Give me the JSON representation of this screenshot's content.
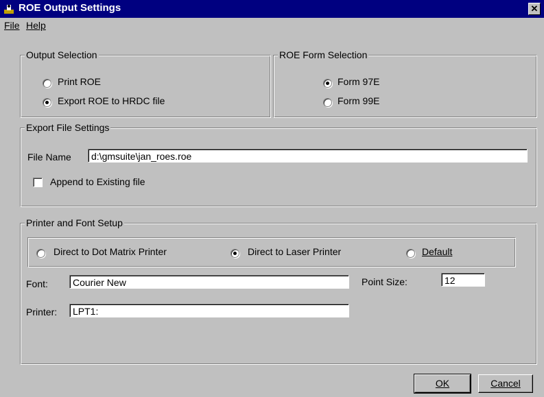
{
  "window": {
    "title": "ROE Output Settings",
    "icon": "app-icon",
    "close_glyph": "✕"
  },
  "menu": {
    "file": "File",
    "help": "Help"
  },
  "output_selection": {
    "title": "Output Selection",
    "options": [
      {
        "label": "Print ROE",
        "selected": false
      },
      {
        "label": "Export ROE to HRDC file",
        "selected": true
      }
    ]
  },
  "roe_form_selection": {
    "title": "ROE Form Selection",
    "options": [
      {
        "label": "Form 97E",
        "selected": true
      },
      {
        "label": "Form 99E",
        "selected": false
      }
    ]
  },
  "export_file_settings": {
    "title": "Export File Settings",
    "file_name_label": "File Name",
    "file_name_value": "d:\\gmsuite\\jan_roes.roe",
    "append_label": "Append to Existing file",
    "append_checked": false
  },
  "printer_font_setup": {
    "title": "Printer and Font Setup",
    "printer_options": [
      {
        "label": "Direct to Dot Matrix Printer",
        "selected": false
      },
      {
        "label": "Direct to Laser Printer",
        "selected": true
      },
      {
        "label": "Default",
        "selected": false
      }
    ],
    "font_label": "Font:",
    "font_value": "Courier New",
    "point_size_label": "Point Size:",
    "point_size_value": "12",
    "printer_label": "Printer:",
    "printer_value": "LPT1:"
  },
  "buttons": {
    "ok": "OK",
    "cancel": "Cancel"
  },
  "colors": {
    "titlebar": "#000080",
    "face": "#c0c0c0"
  }
}
